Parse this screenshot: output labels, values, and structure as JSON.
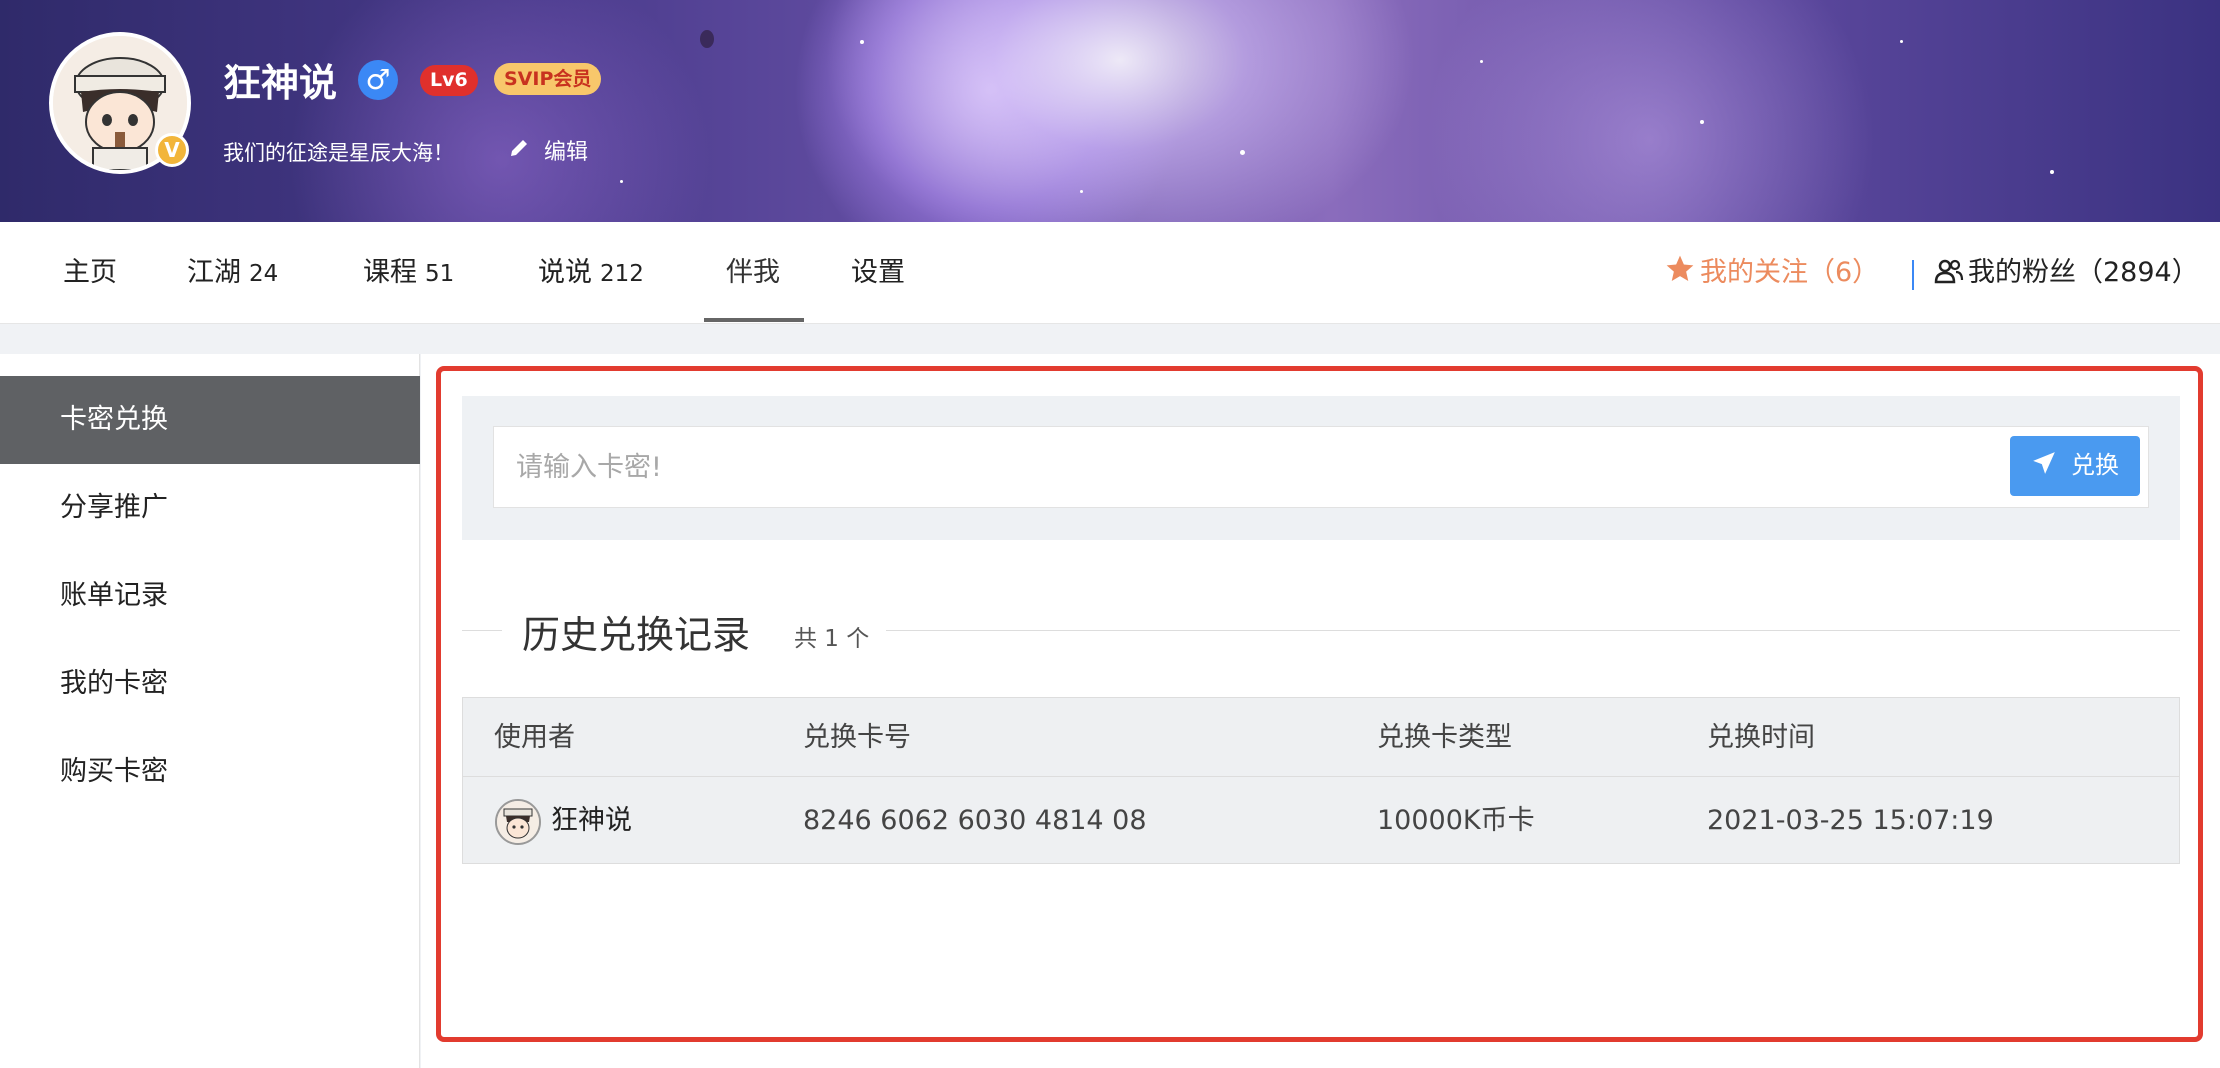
{
  "profile": {
    "name": "狂神说",
    "gender_symbol": "♂",
    "level": "Lv6",
    "vip": "SVIP会员",
    "badge": "V",
    "motto": "我们的征途是星辰大海！",
    "edit_label": "编辑"
  },
  "nav": {
    "items": [
      {
        "label": "主页",
        "count": ""
      },
      {
        "label": "江湖",
        "count": "24"
      },
      {
        "label": "课程",
        "count": "51"
      },
      {
        "label": "说说",
        "count": "212"
      },
      {
        "label": "伴我",
        "count": ""
      },
      {
        "label": "设置",
        "count": ""
      }
    ],
    "active": "伴我",
    "follow_label": "我的关注（6）",
    "fans_label": "我的粉丝（2894）"
  },
  "sidebar": {
    "items": [
      {
        "label": "卡密兑换"
      },
      {
        "label": "分享推广"
      },
      {
        "label": "账单记录"
      },
      {
        "label": "我的卡密"
      },
      {
        "label": "购买卡密"
      }
    ],
    "active": "卡密兑换"
  },
  "redeem": {
    "placeholder": "请输入卡密!",
    "button_label": "兑换"
  },
  "history": {
    "title": "历史兑换记录",
    "count_label": "共 1 个",
    "columns": [
      "使用者",
      "兑换卡号",
      "兑换卡类型",
      "兑换时间"
    ],
    "rows": [
      {
        "user": "狂神说",
        "card_no": "8246 6062 6030 4814 08",
        "card_type": "10000K币卡",
        "time": "2021-03-25 15:07:19"
      }
    ]
  },
  "colors": {
    "accent_blue": "#4a9af0",
    "follow_orange": "#ec8b5e",
    "highlight_red": "#e23b2f",
    "sidebar_active": "#5f6164"
  }
}
